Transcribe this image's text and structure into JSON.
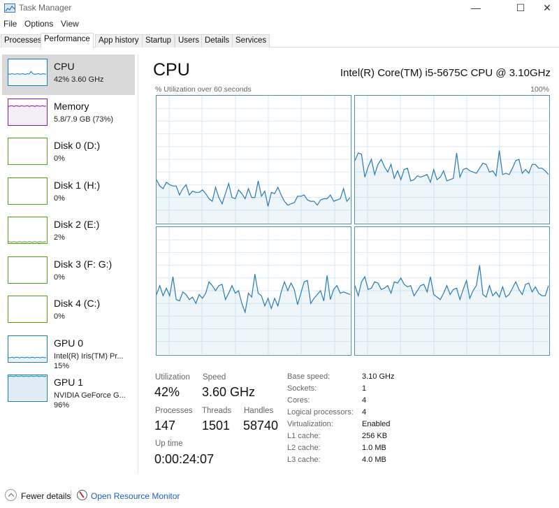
{
  "window": {
    "title": "Task Manager",
    "controls": {
      "minimize": "—",
      "maximize": "☐",
      "close": "✕"
    }
  },
  "menu": [
    "File",
    "Options",
    "View"
  ],
  "tabs": [
    {
      "label": "Processes",
      "active": false
    },
    {
      "label": "Performance",
      "active": true
    },
    {
      "label": "App history",
      "active": false
    },
    {
      "label": "Startup",
      "active": false
    },
    {
      "label": "Users",
      "active": false
    },
    {
      "label": "Details",
      "active": false
    },
    {
      "label": "Services",
      "active": false
    }
  ],
  "sidebar": {
    "items": [
      {
        "name": "CPU",
        "sub": "42% 3.60 GHz",
        "color": "#117dbb",
        "selected": true,
        "level": 42
      },
      {
        "name": "Memory",
        "sub": "5.8/7.9 GB (73%)",
        "color": "#8b12ae",
        "selected": false,
        "level": 73
      },
      {
        "name": "Disk 0 (D:)",
        "sub": "0%",
        "color": "#4da60c",
        "selected": false,
        "level": 0
      },
      {
        "name": "Disk 1 (H:)",
        "sub": "0%",
        "color": "#4da60c",
        "selected": false,
        "level": 0
      },
      {
        "name": "Disk 2 (E:)",
        "sub": "2%",
        "color": "#4da60c",
        "selected": false,
        "level": 2
      },
      {
        "name": "Disk 3 (F: G:)",
        "sub": "0%",
        "color": "#4da60c",
        "selected": false,
        "level": 0
      },
      {
        "name": "Disk 4 (C:)",
        "sub": "0%",
        "color": "#4da60c",
        "selected": false,
        "level": 0
      },
      {
        "name": "GPU 0",
        "sub": "Intel(R) Iris(TM) Pr...",
        "sub2": "15%",
        "color": "#117dbb",
        "selected": false,
        "level": 15
      },
      {
        "name": "GPU 1",
        "sub": "NVIDIA GeForce G...",
        "sub2": "96%",
        "color": "#117dbb",
        "selected": false,
        "level": 96
      }
    ]
  },
  "main": {
    "title": "CPU",
    "model": "Intel(R) Core(TM) i5-5675C CPU @ 3.10GHz",
    "graph_label": "% Utilization over 60 seconds",
    "graph_max": "100%",
    "stats": {
      "utilization_label": "Utilization",
      "utilization": "42%",
      "speed_label": "Speed",
      "speed": "3.60 GHz",
      "processes_label": "Processes",
      "processes": "147",
      "threads_label": "Threads",
      "threads": "1501",
      "handles_label": "Handles",
      "handles": "58740",
      "uptime_label": "Up time",
      "uptime": "0:00:24:07"
    },
    "info": [
      {
        "label": "Base speed:",
        "value": "3.10 GHz"
      },
      {
        "label": "Sockets:",
        "value": "1"
      },
      {
        "label": "Cores:",
        "value": "4"
      },
      {
        "label": "Logical processors:",
        "value": "4"
      },
      {
        "label": "Virtualization:",
        "value": "Enabled"
      },
      {
        "label": "L1 cache:",
        "value": "256 KB"
      },
      {
        "label": "L2 cache:",
        "value": "1.0 MB"
      },
      {
        "label": "L3 cache:",
        "value": "4.0 MB"
      }
    ]
  },
  "footer": {
    "fewer_details": "Fewer details",
    "open_resource_monitor": "Open Resource Monitor"
  },
  "chart_data": {
    "type": "area",
    "title": "% Utilization over 60 seconds",
    "ylim": [
      0,
      100
    ],
    "ymax_label": "100%",
    "grid": true,
    "series": [
      {
        "name": "Logical processor 0",
        "values": [
          34,
          29,
          27,
          32,
          30,
          29,
          29,
          22,
          27,
          30,
          22,
          25,
          24,
          24,
          26,
          23,
          19,
          17,
          28,
          20,
          15,
          23,
          31,
          20,
          19,
          26,
          23,
          19,
          27,
          20,
          20,
          33,
          21,
          25,
          13,
          24,
          23,
          28,
          22,
          17,
          14,
          15,
          16,
          21,
          21,
          22,
          18,
          17,
          17,
          14,
          18,
          19,
          19,
          22,
          17,
          18,
          19,
          27,
          17,
          20
        ]
      },
      {
        "name": "Logical processor 1",
        "values": [
          49,
          55,
          54,
          36,
          44,
          50,
          38,
          46,
          50,
          44,
          40,
          46,
          35,
          41,
          34,
          42,
          43,
          33,
          34,
          37,
          36,
          37,
          38,
          32,
          42,
          34,
          36,
          41,
          33,
          34,
          35,
          55,
          36,
          42,
          43,
          41,
          40,
          39,
          43,
          47,
          46,
          40,
          41,
          37,
          57,
          38,
          39,
          38,
          43,
          49,
          50,
          39,
          42,
          39,
          46,
          46,
          43,
          43,
          41,
          38
        ]
      },
      {
        "name": "Logical processor 2",
        "values": [
          47,
          54,
          46,
          52,
          46,
          61,
          43,
          42,
          49,
          47,
          43,
          45,
          40,
          47,
          44,
          48,
          57,
          54,
          50,
          54,
          55,
          43,
          48,
          54,
          48,
          50,
          40,
          33,
          48,
          45,
          63,
          48,
          46,
          38,
          44,
          36,
          44,
          38,
          49,
          57,
          50,
          56,
          51,
          39,
          48,
          57,
          58,
          40,
          44,
          47,
          50,
          42,
          62,
          43,
          51,
          54,
          48,
          49,
          48,
          47
        ]
      },
      {
        "name": "Logical processor 3",
        "values": [
          54,
          46,
          57,
          61,
          51,
          52,
          57,
          56,
          51,
          52,
          54,
          48,
          57,
          56,
          60,
          55,
          53,
          54,
          46,
          50,
          54,
          55,
          49,
          61,
          47,
          45,
          43,
          48,
          54,
          47,
          51,
          52,
          43,
          51,
          58,
          44,
          50,
          54,
          70,
          47,
          45,
          54,
          46,
          49,
          45,
          53,
          45,
          47,
          52,
          57,
          51,
          47,
          55,
          56,
          49,
          53,
          48,
          46,
          46,
          54
        ]
      }
    ]
  }
}
